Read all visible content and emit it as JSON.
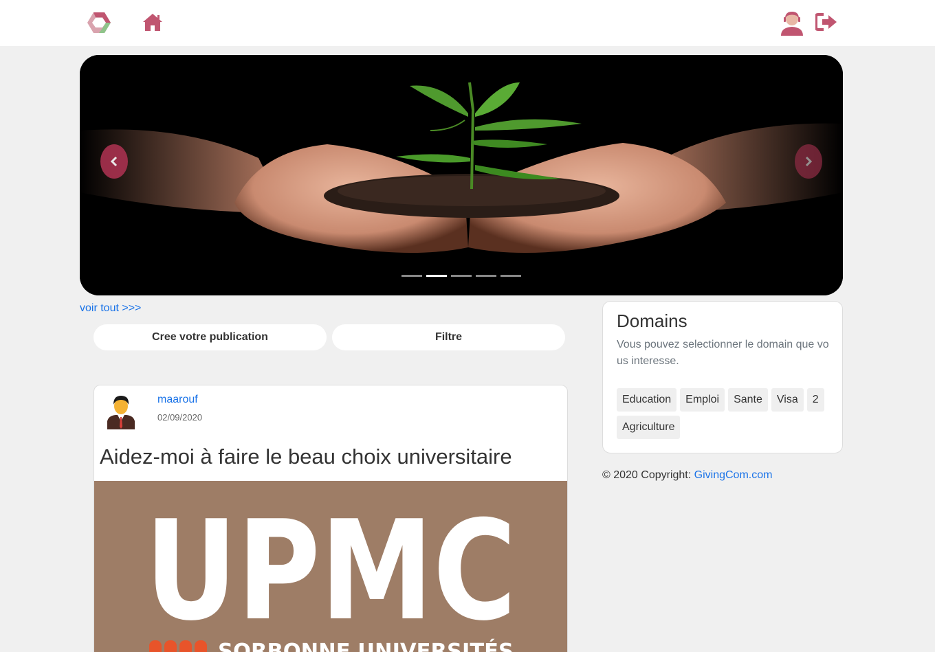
{
  "header": {
    "logo_icon": "hexagon-logo-icon",
    "home_icon": "home-icon",
    "user_icon": "user-avatar-icon",
    "logout_icon": "logout-icon",
    "accent_color": "#c05570"
  },
  "carousel": {
    "prev_icon": "chevron-left-icon",
    "next_icon": "chevron-right-icon",
    "slide_count": 5,
    "active_slide": 2
  },
  "links": {
    "voir_tout": "voir tout >>>"
  },
  "actions": {
    "create_label": "Cree votre publication",
    "filter_label": "Filtre"
  },
  "post": {
    "author": "maarouf",
    "date": "02/09/2020",
    "title": "Aidez-moi à faire le beau choix universitaire",
    "image_text_main": "UPMC",
    "image_text_sub": "SORBONNE UNIVERSITÉS"
  },
  "domains": {
    "title": "Domains",
    "description": "Vous pouvez selectionner le domain que vous interesse.",
    "tags": [
      "Education",
      "Emploi",
      "Sante",
      "Visa",
      "2",
      "Agriculture"
    ]
  },
  "footer": {
    "copyright_prefix": "© 2020 Copyright: ",
    "copyright_link": "GivingCom.com"
  }
}
